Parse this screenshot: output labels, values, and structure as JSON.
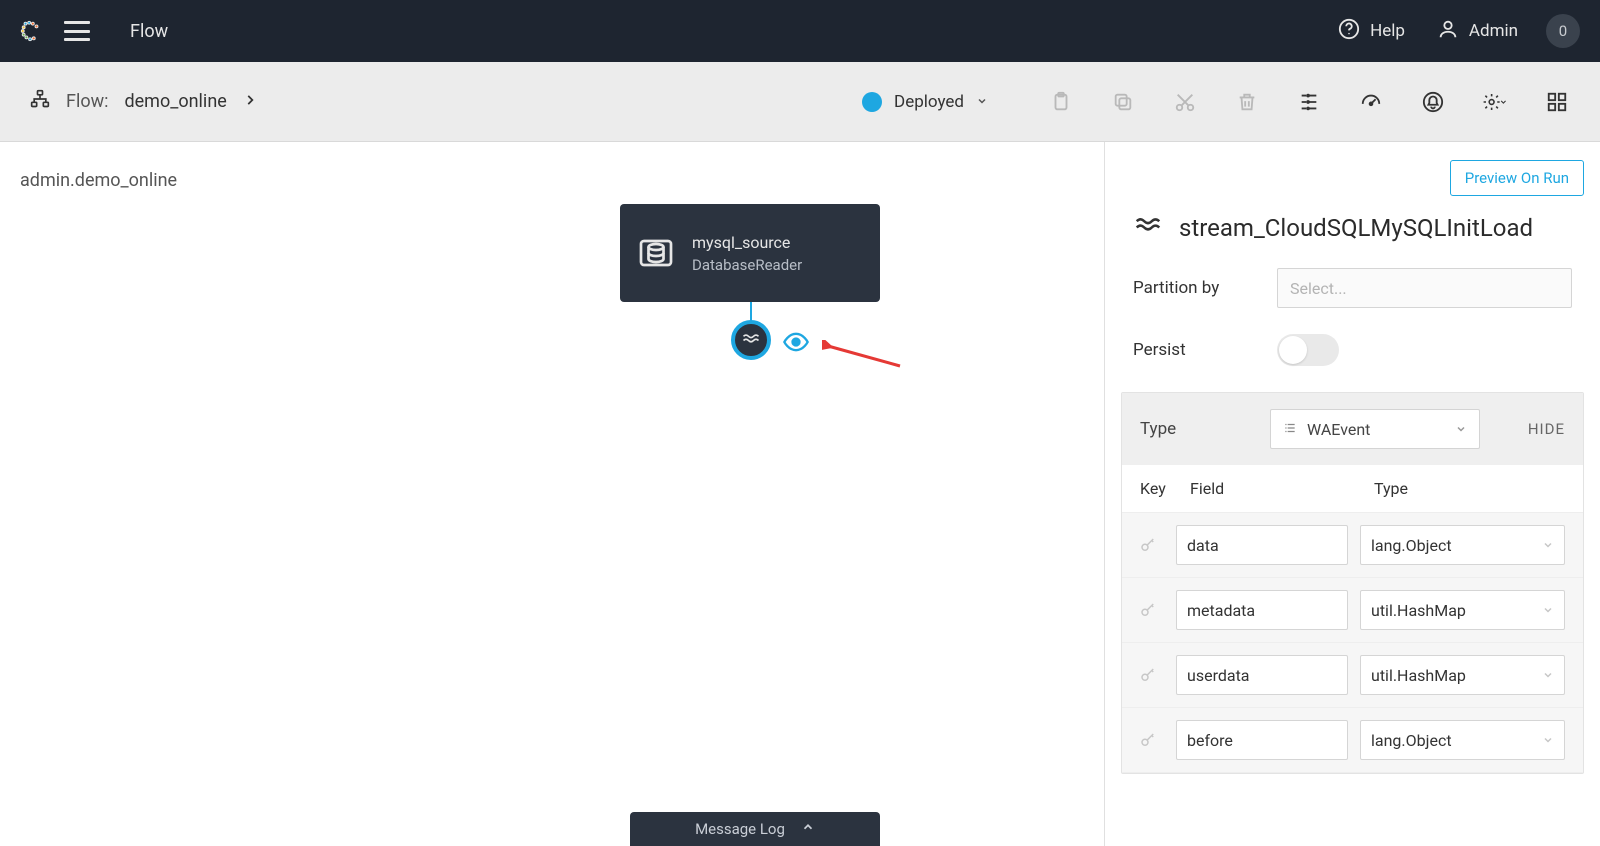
{
  "topbar": {
    "title": "Flow",
    "help": "Help",
    "admin": "Admin",
    "badge": "0"
  },
  "subbar": {
    "crumb_label": "Flow:",
    "crumb_name": "demo_online",
    "status": "Deployed"
  },
  "canvas": {
    "breadcrumb": "admin.demo_online",
    "node_title": "mysql_source",
    "node_sub": "DatabaseReader",
    "message_log": "Message Log"
  },
  "panel": {
    "preview_btn": "Preview On Run",
    "title": "stream_CloudSQLMySQLInitLoad",
    "partition_label": "Partition by",
    "partition_placeholder": "Select...",
    "persist_label": "Persist",
    "type_label": "Type",
    "type_value": "WAEvent",
    "hide_label": "HIDE",
    "col_key": "Key",
    "col_field": "Field",
    "col_type": "Type",
    "rows": [
      {
        "field": "data",
        "type": "lang.Object"
      },
      {
        "field": "metadata",
        "type": "util.HashMap"
      },
      {
        "field": "userdata",
        "type": "util.HashMap"
      },
      {
        "field": "before",
        "type": "lang.Object"
      }
    ]
  }
}
